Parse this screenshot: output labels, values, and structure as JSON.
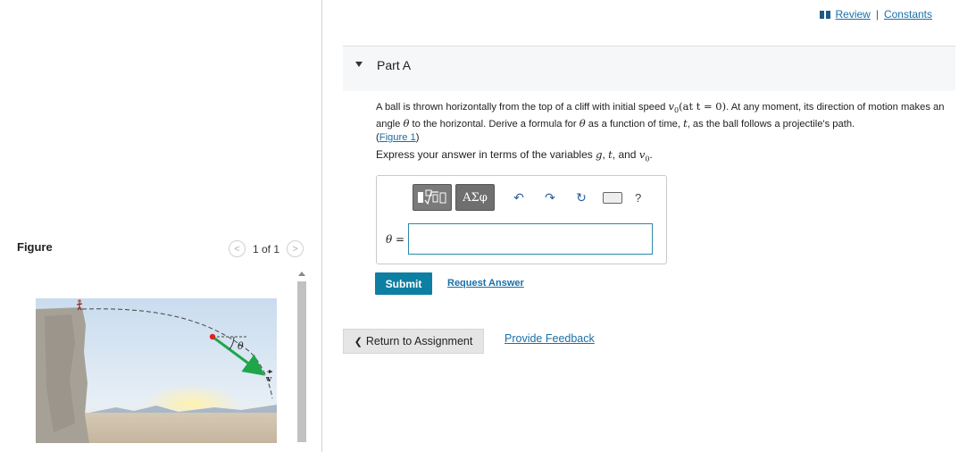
{
  "header": {
    "review_label": "Review",
    "separator": "|",
    "constants_label": "Constants"
  },
  "figure_panel": {
    "title": "Figure",
    "page_indicator": "1 of 1",
    "labels": {
      "angle": "θ",
      "velocity": "v"
    }
  },
  "part": {
    "title": "Part A"
  },
  "question": {
    "text_1": "A ball is thrown horizontally from the top of a cliff with initial speed ",
    "speed_symbol": "v",
    "speed_subscript": "0",
    "at_time": "(at t = 0)",
    "text_2": ". At any moment, its direction of motion makes an angle ",
    "theta": "θ",
    "text_3": " to the horizontal. Derive a formula for ",
    "theta_2": "θ",
    "text_4": " as a function of time, ",
    "t_symbol": "t",
    "text_5": ", as the ball follows a projectile's path.",
    "figure_link": "Figure 1"
  },
  "instruction": {
    "prefix": "Express your answer in terms of the variables ",
    "g": "g",
    "comma_1": ", ",
    "t": "t",
    "and": ", and ",
    "v": "v",
    "sub": "0",
    "suffix": "."
  },
  "answer": {
    "toolbar": {
      "greek_label": "ΑΣφ",
      "help_label": "?"
    },
    "variable_label": "θ =",
    "input_value": ""
  },
  "actions": {
    "submit_label": "Submit",
    "request_answer_label": "Request Answer",
    "return_label": "Return to Assignment",
    "return_chevron": "❮",
    "feedback_label": "Provide Feedback"
  },
  "colors": {
    "accent": "#0d7fa3",
    "link": "#1a6fa8",
    "vector": "#1fa54a",
    "ball": "#e02020"
  }
}
